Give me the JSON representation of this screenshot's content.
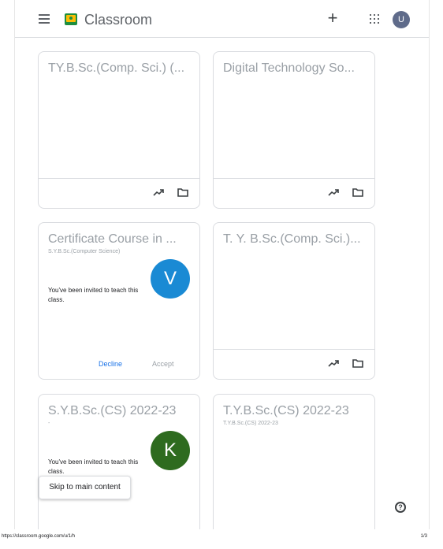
{
  "header": {
    "app_title": "Classroom",
    "menu_icon": "hamburger-menu-icon",
    "logo_icon": "classroom-logo-icon",
    "create_label": "+",
    "apps_icon": "grid-apps-icon",
    "avatar_initial": "U",
    "avatar_color": "#5f6b8a"
  },
  "cards": [
    {
      "title": "TY.B.Sc.(Comp. Sci.) (...",
      "subtitle": "",
      "type": "class"
    },
    {
      "title": "Digital Technology So...",
      "subtitle": "",
      "type": "class"
    },
    {
      "title": "Certificate Course in ...",
      "subtitle": "S.Y.B.Sc.(Computer Science)",
      "type": "invite",
      "invite_text": "You've been invited to teach this class.",
      "avatar_initial": "V",
      "avatar_color": "#1a8ad4",
      "decline_label": "Decline",
      "accept_label": "Accept"
    },
    {
      "title": "T. Y. B.Sc.(Comp. Sci.)...",
      "subtitle": "",
      "type": "class"
    },
    {
      "title": "S.Y.B.Sc.(CS) 2022-23",
      "subtitle": "-",
      "type": "invite",
      "invite_text": "You've been invited to teach this class.",
      "avatar_initial": "K",
      "avatar_color": "#2e6b1f"
    },
    {
      "title": "T.Y.B.Sc.(CS) 2022-23",
      "subtitle": "T.Y.B.Sc.(CS) 2022-23",
      "type": "class"
    }
  ],
  "skip_link": "Skip to main content",
  "help_label": "?",
  "print_footer": {
    "url": "https://classroom.google.com/u/1/h",
    "page": "1/3"
  }
}
